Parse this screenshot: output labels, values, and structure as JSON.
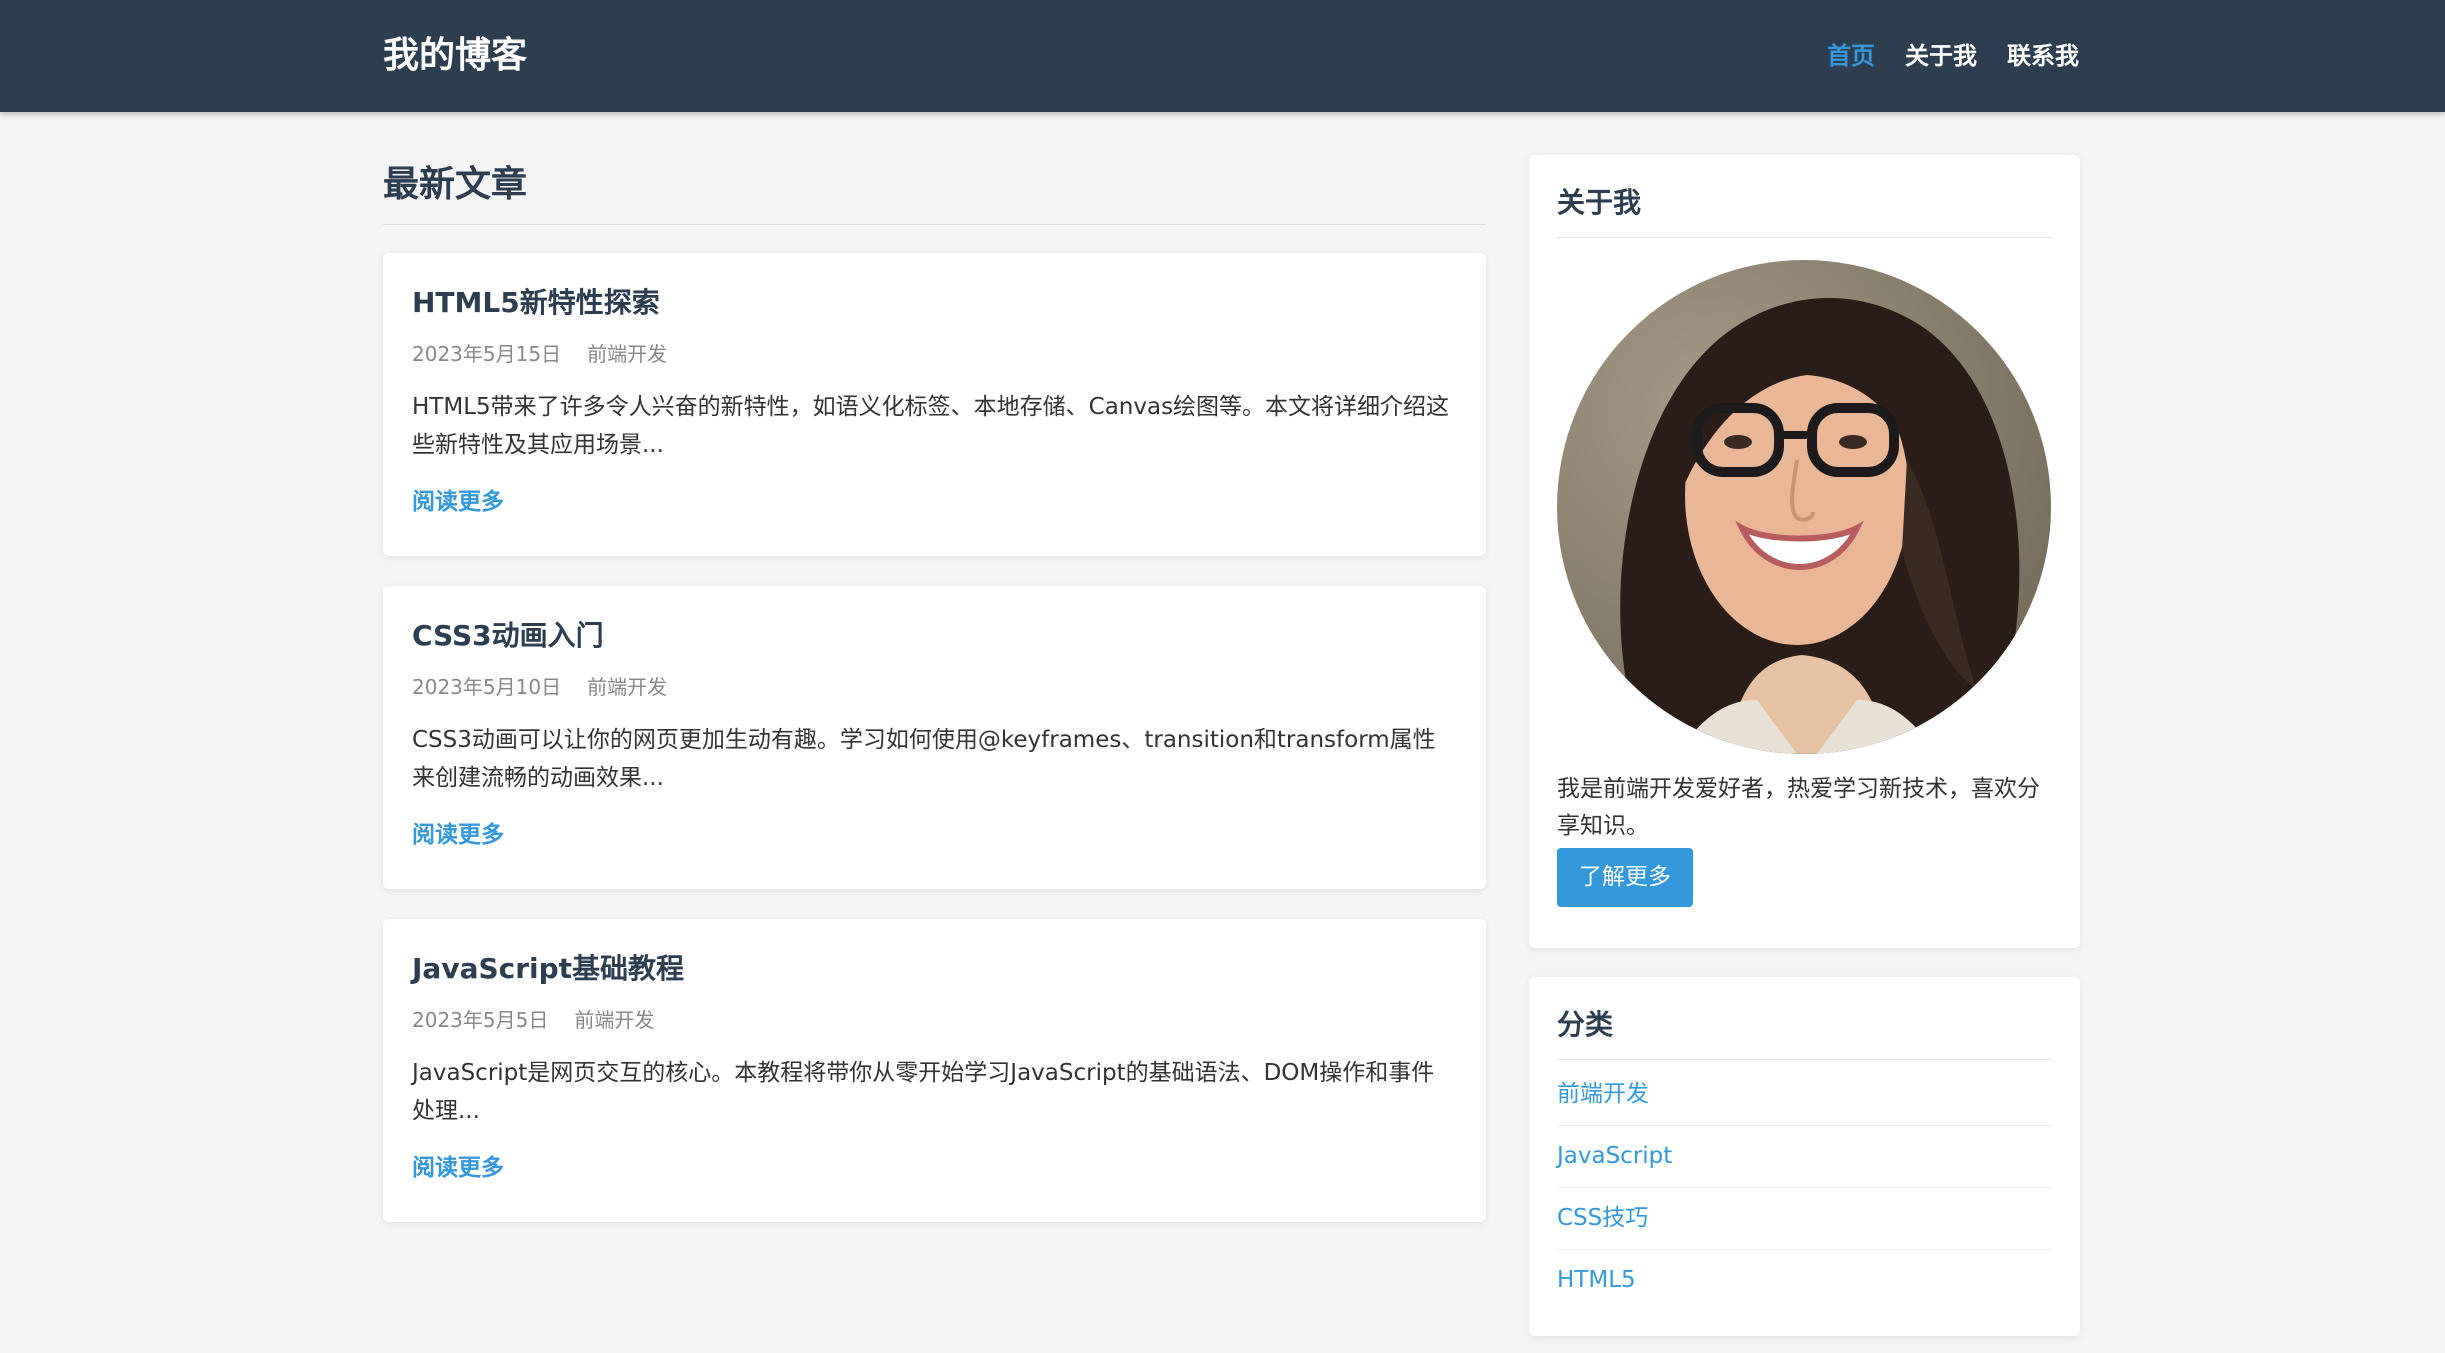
{
  "header": {
    "logo": "我的博客",
    "nav": [
      {
        "label": "首页",
        "active": true
      },
      {
        "label": "关于我",
        "active": false
      },
      {
        "label": "联系我",
        "active": false
      }
    ]
  },
  "main": {
    "section_title": "最新文章",
    "articles": [
      {
        "title": "HTML5新特性探索",
        "date": "2023年5月15日",
        "category": "前端开发",
        "excerpt": "HTML5带来了许多令人兴奋的新特性，如语义化标签、本地存储、Canvas绘图等。本文将详细介绍这些新特性及其应用场景...",
        "link": "阅读更多"
      },
      {
        "title": "CSS3动画入门",
        "date": "2023年5月10日",
        "category": "前端开发",
        "excerpt": "CSS3动画可以让你的网页更加生动有趣。学习如何使用@keyframes、transition和transform属性来创建流畅的动画效果...",
        "link": "阅读更多"
      },
      {
        "title": "JavaScript基础教程",
        "date": "2023年5月5日",
        "category": "前端开发",
        "excerpt": "JavaScript是网页交互的核心。本教程将带你从零开始学习JavaScript的基础语法、DOM操作和事件处理...",
        "link": "阅读更多"
      }
    ]
  },
  "sidebar": {
    "about": {
      "title": "关于我",
      "avatar_icon": "profile-photo",
      "text": "我是前端开发爱好者，热爱学习新技术，喜欢分享知识。",
      "button": "了解更多"
    },
    "categories": {
      "title": "分类",
      "items": [
        "前端开发",
        "JavaScript",
        "CSS技巧",
        "HTML5"
      ]
    }
  },
  "colors": {
    "header_bg": "#2c3e50",
    "accent": "#3498db",
    "page_bg": "#f4f4f4"
  }
}
